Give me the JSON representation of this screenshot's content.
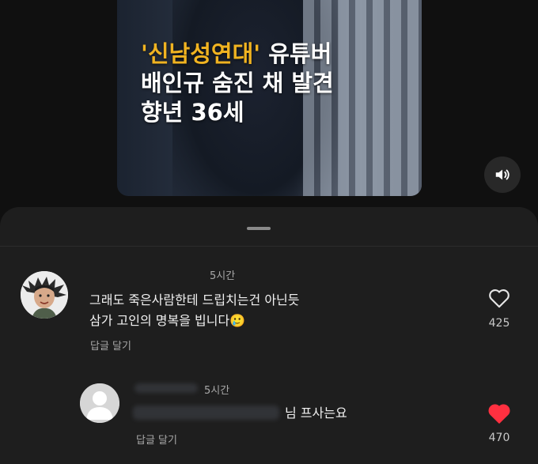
{
  "video": {
    "headline_highlight": "'신남성연대'",
    "headline_line1_rest": " 유튜버",
    "headline_line2": "배인규 숨진 채 발견",
    "headline_line3": "향년 36세"
  },
  "comments": [
    {
      "time": "5시간",
      "line1": "그래도 죽은사람한테  드립치는건 아닌듯",
      "line2": "삼가 고인의 명복을 빕니다🥲",
      "reply_label": "답글 달기",
      "likes": "425",
      "liked": false
    },
    {
      "time": "5시간",
      "text": "님 프사는요",
      "reply_label": "답글 달기",
      "likes": "470",
      "liked": true
    }
  ],
  "colors": {
    "headline_accent": "#f0b321",
    "liked_heart": "#ff3040"
  },
  "icons": [
    "speaker-icon",
    "heart-outline-icon",
    "heart-filled-icon",
    "default-avatar-icon"
  ]
}
